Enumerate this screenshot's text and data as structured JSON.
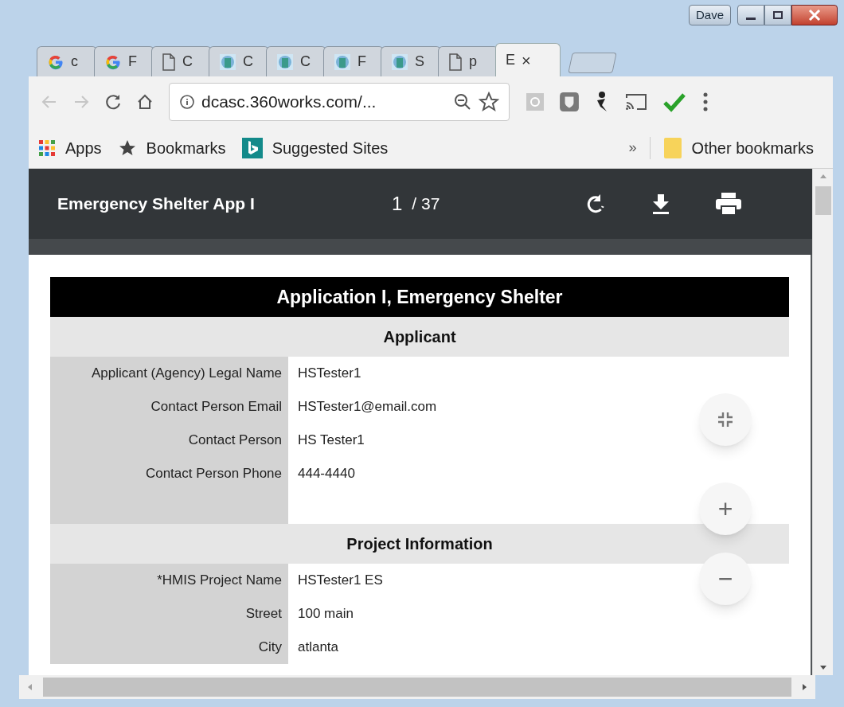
{
  "window": {
    "user": "Dave"
  },
  "tabs": [
    {
      "kind": "google",
      "label": "c",
      "selected": false
    },
    {
      "kind": "google",
      "label": "F",
      "selected": false
    },
    {
      "kind": "doc",
      "label": "C",
      "selected": false
    },
    {
      "kind": "app",
      "label": "C",
      "selected": false
    },
    {
      "kind": "app",
      "label": "C",
      "selected": false
    },
    {
      "kind": "app",
      "label": "F",
      "selected": false
    },
    {
      "kind": "app",
      "label": "S",
      "selected": false
    },
    {
      "kind": "doc",
      "label": "p",
      "selected": false
    },
    {
      "kind": "none",
      "label": "E",
      "selected": true,
      "close": "×"
    }
  ],
  "address_bar": {
    "url": "dcasc.360works.com/..."
  },
  "bookmarks": [
    {
      "kind": "apps",
      "label": "Apps"
    },
    {
      "kind": "star",
      "label": "Bookmarks"
    },
    {
      "kind": "bing",
      "label": "Suggested Sites"
    }
  ],
  "bookmarks_overflow": "»",
  "other_bookmarks": "Other bookmarks",
  "pdf_toolbar": {
    "title": "Emergency Shelter App I",
    "page": "1",
    "total": "/ 37"
  },
  "document": {
    "title": "Application I, Emergency Shelter",
    "sections": [
      {
        "heading": "Applicant",
        "rows": [
          {
            "label": "Applicant (Agency) Legal Name",
            "value": "HSTester1"
          },
          {
            "label": "Contact Person Email",
            "value": "HSTester1@email.com"
          },
          {
            "label": "Contact Person",
            "value": "HS Tester1"
          },
          {
            "label": "Contact Person Phone",
            "value": "444-4440"
          }
        ]
      },
      {
        "heading": "Project Information",
        "rows": [
          {
            "label": "*HMIS Project Name",
            "value": "HSTester1 ES"
          },
          {
            "label": "Street",
            "value": "100 main"
          },
          {
            "label": "City",
            "value": "atlanta"
          }
        ]
      }
    ]
  },
  "zoom_controls": {
    "zoom_in": "+",
    "zoom_out": "−"
  }
}
